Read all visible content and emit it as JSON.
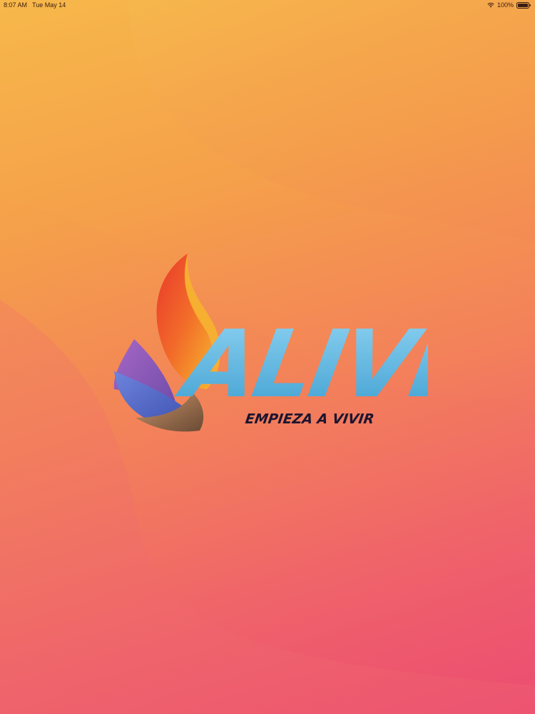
{
  "status_bar": {
    "time": "8:07 AM",
    "date": "Tue May 14",
    "battery": "100%",
    "wifi_icon": "wifi-icon",
    "battery_icon": "battery-icon"
  },
  "logo": {
    "wordmark": "ALIVE",
    "tagline": "EMPIEZA A VIVIR",
    "colors": {
      "wordmark": "#6fc0e6",
      "tagline": "#1c1530",
      "flame_orange": "#f26a2a",
      "flame_yellow": "#f6b52c",
      "wing_purple": "#8a5bb8",
      "wing_blue": "#5568c9"
    }
  },
  "background": {
    "gradient_top": "#f7b84a",
    "gradient_bottom": "#ec4a72"
  }
}
